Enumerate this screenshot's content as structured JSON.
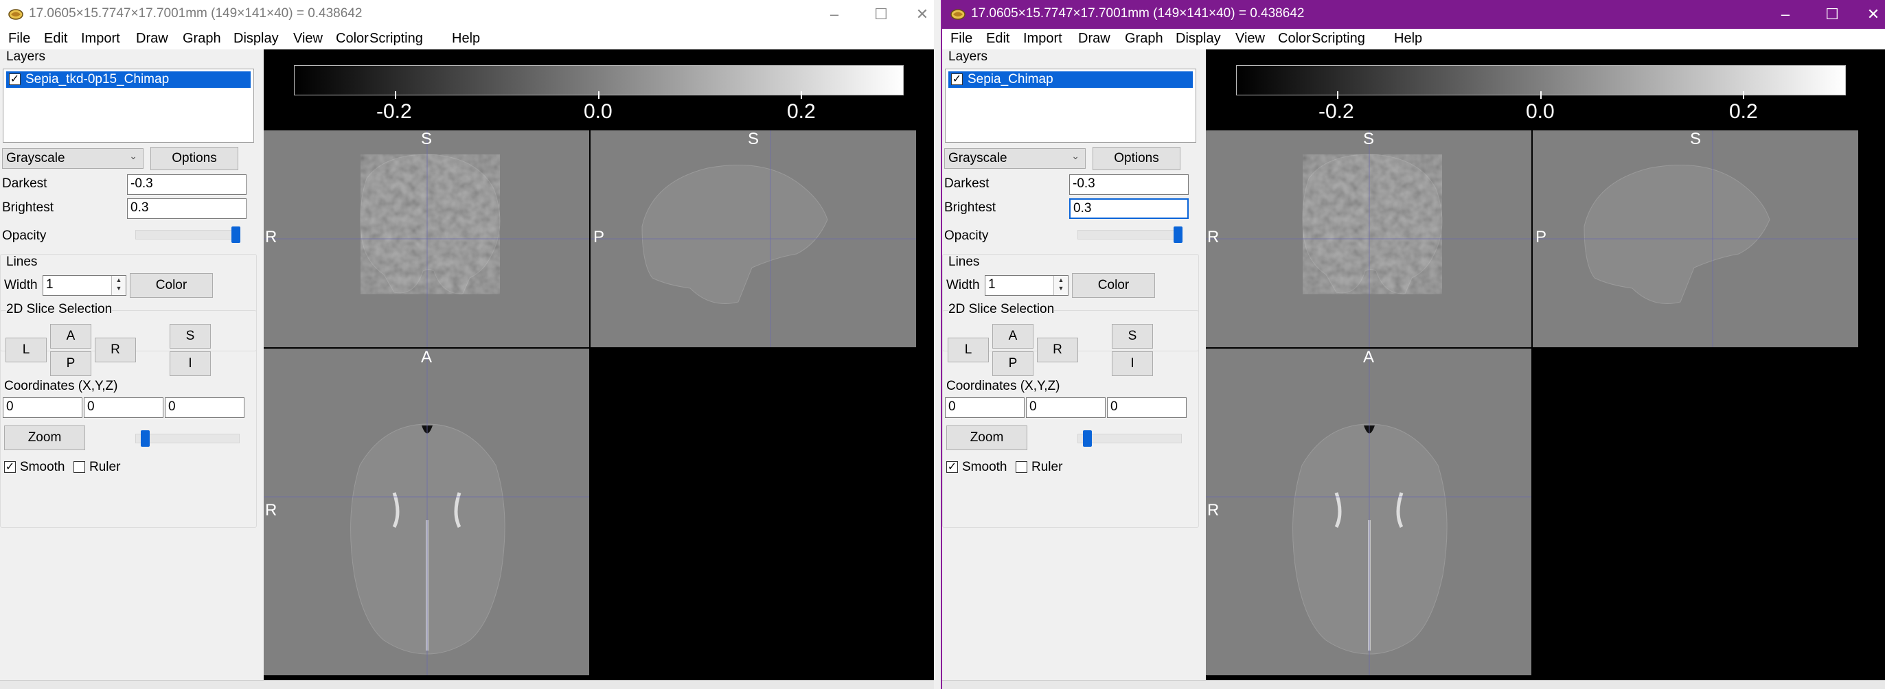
{
  "windows": [
    {
      "title": "17.0605×15.7747×17.7001mm (149×141×40) =  0.438642",
      "menu": [
        "File",
        "Edit",
        "Import",
        "Draw",
        "Graph",
        "Display",
        "View",
        "Color",
        "Scripting",
        "Help"
      ],
      "layers_label": "Layers",
      "layer_name": "Sepia_tkd-0p15_Chimap",
      "colormap": "Grayscale",
      "options_label": "Options",
      "darkest_label": "Darkest",
      "darkest_value": "-0.3",
      "brightest_label": "Brightest",
      "brightest_value": "0.3",
      "opacity_label": "Opacity",
      "opacity_level": 1.0,
      "lines_label": "Lines",
      "width_label": "Width",
      "width_value": "1",
      "color_label": "Color",
      "slice_label": "2D Slice Selection",
      "btn_L": "L",
      "btn_A": "A",
      "btn_P": "P",
      "btn_R": "R",
      "btn_S": "S",
      "btn_I": "I",
      "coords_label": "Coordinates (X,Y,Z)",
      "coord_x": "0",
      "coord_y": "0",
      "coord_z": "0",
      "zoom_label": "Zoom",
      "zoom_level": 0.05,
      "smooth_label": "Smooth",
      "ruler_label": "Ruler",
      "cbar_labels": [
        "-0.2",
        "0.0",
        "0.2"
      ],
      "orient": {
        "cor_top": "S",
        "cor_left": "R",
        "sag_top": "S",
        "sag_left": "P",
        "ax_top": "A",
        "ax_left": "R"
      }
    },
    {
      "title": "17.0605×15.7747×17.7001mm (149×141×40) =  0.438642",
      "menu": [
        "File",
        "Edit",
        "Import",
        "Draw",
        "Graph",
        "Display",
        "View",
        "Color",
        "Scripting",
        "Help"
      ],
      "layers_label": "Layers",
      "layer_name": "Sepia_Chimap",
      "colormap": "Grayscale",
      "options_label": "Options",
      "darkest_label": "Darkest",
      "darkest_value": "-0.3",
      "brightest_label": "Brightest",
      "brightest_value": "0.3",
      "opacity_label": "Opacity",
      "opacity_level": 1.0,
      "lines_label": "Lines",
      "width_label": "Width",
      "width_value": "1",
      "color_label": "Color",
      "slice_label": "2D Slice Selection",
      "btn_L": "L",
      "btn_A": "A",
      "btn_P": "P",
      "btn_R": "R",
      "btn_S": "S",
      "btn_I": "I",
      "coords_label": "Coordinates (X,Y,Z)",
      "coord_x": "0",
      "coord_y": "0",
      "coord_z": "0",
      "zoom_label": "Zoom",
      "zoom_level": 0.05,
      "smooth_label": "Smooth",
      "ruler_label": "Ruler",
      "cbar_labels": [
        "-0.2",
        "0.0",
        "0.2"
      ],
      "orient": {
        "cor_top": "S",
        "cor_left": "R",
        "sag_top": "S",
        "sag_left": "P",
        "ax_top": "A",
        "ax_left": "R"
      }
    }
  ]
}
